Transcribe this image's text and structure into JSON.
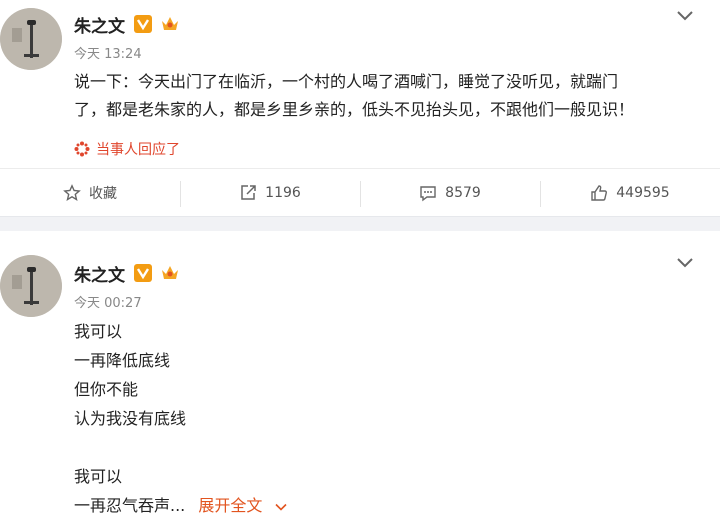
{
  "post1": {
    "author": "朱之文",
    "time": "今天 13:24",
    "text_line1": "说一下：今天出门了在临沂，一个村的人喝了酒喊门，睡觉了没听见，就踹门",
    "text_line2": "了，都是老朱家的人，都是乡里乡亲的，低头不见抬头见，不跟他们一般见识！",
    "reply_label": "当事人回应了",
    "actions": {
      "favorite": "收藏",
      "repost": "1196",
      "comment": "8579",
      "like": "449595"
    }
  },
  "post2": {
    "author": "朱之文",
    "time": "今天 00:27",
    "lines": [
      "我可以",
      "一再降低底线",
      "但你不能",
      "认为我没有底线",
      "",
      "我可以"
    ],
    "last_line": "一再忍气吞声...",
    "expand_label": "展开全文"
  },
  "colors": {
    "accent_orange": "#e2541f",
    "reply_red": "#e0462d",
    "badge_orange": "#f39c12"
  }
}
